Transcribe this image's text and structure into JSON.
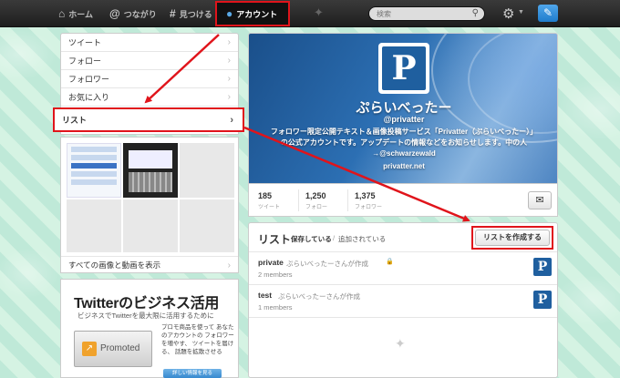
{
  "topbar": {
    "nav": [
      {
        "label": "ホーム",
        "icon": "home-icon"
      },
      {
        "label": "つながり",
        "icon": "at-icon"
      },
      {
        "label": "見つける",
        "icon": "hashtag-icon"
      },
      {
        "label": "アカウント",
        "icon": "person-icon",
        "active": true
      }
    ],
    "search_placeholder": "検索"
  },
  "sidebar": {
    "items": [
      {
        "label": "ツイート"
      },
      {
        "label": "フォロー"
      },
      {
        "label": "フォロワー"
      },
      {
        "label": "お気に入り"
      },
      {
        "label": "リスト",
        "selected": true
      }
    ],
    "media_link": "すべての画像と動画を表示"
  },
  "business_ad": {
    "title": "Twitterのビジネス活用",
    "subtitle": "ビジネスでTwitterを最大限に活用するために",
    "promoted_label": "Promoted",
    "description": "プロモ商品を使って あなたのアカウントの フォロワーを増やす、 ツイートを届ける、 話題を拡散させる",
    "button_label": "詳しい情報を見る"
  },
  "profile": {
    "name": "ぷらいべったー",
    "handle": "@privatter",
    "bio": "フォロワー限定公開テキスト＆画像投稿サービス「Privatter（ぷらいべったー）」の公式アカウントです。アップデートの情報などをお知らせします。中の人→@schwarzewald",
    "url": "privatter.net",
    "stats": [
      {
        "count": "185",
        "label": "ツイート"
      },
      {
        "count": "1,250",
        "label": "フォロー"
      },
      {
        "count": "1,375",
        "label": "フォロワー"
      }
    ]
  },
  "lists": {
    "title": "リスト",
    "tab_subscribed": "保存している",
    "tab_separator": "/",
    "tab_member_of": "追加されている",
    "create_button": "リストを作成する",
    "items": [
      {
        "name": "private",
        "created_by": "ぷらいべったーさんが作成",
        "members": "2 members",
        "locked": true
      },
      {
        "name": "test",
        "created_by": "ぷらいべったーさんが作成",
        "members": "1 members",
        "locked": false
      }
    ]
  },
  "colors": {
    "annotation_red": "#e0141b",
    "accent_blue": "#1f7ccc",
    "topbar_bg": "#262626"
  }
}
